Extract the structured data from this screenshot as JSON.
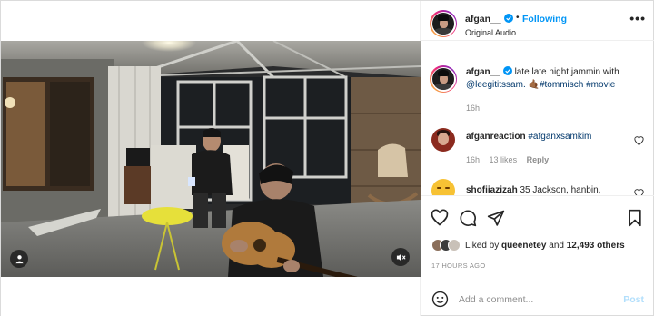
{
  "post": {
    "username": "afgan__",
    "follow_label": "Following",
    "separator": "•",
    "audio": "Original Audio",
    "more_icon": "more-horizontal-icon",
    "verified_color": "#0095f6"
  },
  "caption": {
    "username": "afgan__",
    "text": "late late night jammin with",
    "mention": "@leegititssam.",
    "emoji": "🤙🏾",
    "tags": [
      "#tommisch",
      "#movie"
    ],
    "time": "16h"
  },
  "comments": [
    {
      "username": "afganreaction",
      "text": "#afganxsamkim",
      "time": "16h",
      "likes": "13 likes",
      "reply": "Reply"
    },
    {
      "username": "shofiiazizah",
      "text": "35 Jackson, hanbin,"
    }
  ],
  "actions": {
    "icons": [
      "heart-icon",
      "comment-icon",
      "share-icon",
      "bookmark-icon"
    ]
  },
  "likes": {
    "prefix": "Liked by",
    "user": "queenetey",
    "conjunction": "and",
    "count": "12,493 others"
  },
  "time_ago": "17 HOURS AGO",
  "add_comment": {
    "placeholder": "Add a comment...",
    "post_label": "Post"
  },
  "colors": {
    "accent": "#0095f6",
    "post_disabled": "#b2dffc",
    "link": "#00376b"
  }
}
